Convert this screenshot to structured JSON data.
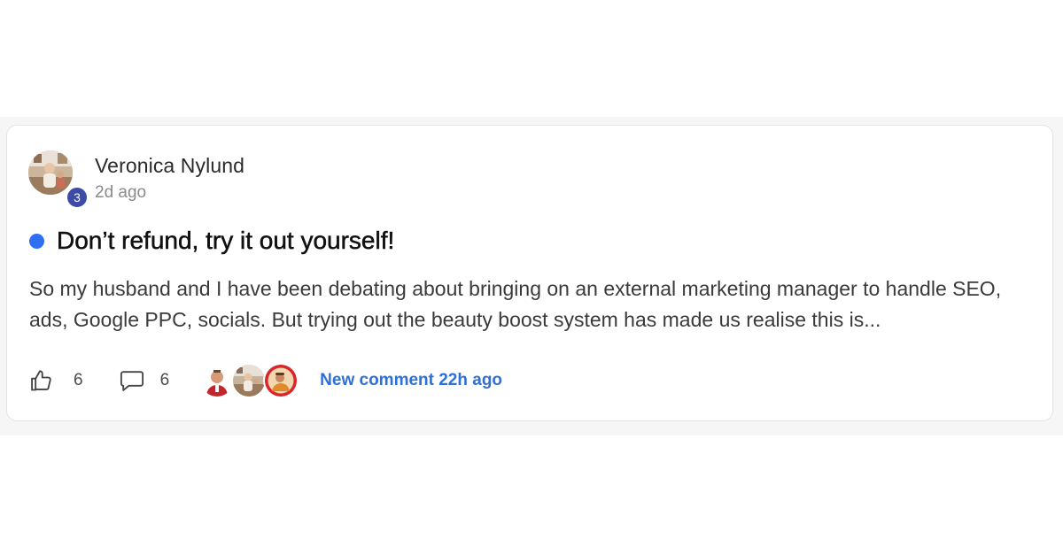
{
  "post": {
    "author": {
      "name": "Veronica Nylund",
      "level": "3",
      "avatar_icon": "user-avatar-photo"
    },
    "time": "2d ago",
    "unread": true,
    "title": "Don’t refund, try it out yourself!",
    "body": "So my husband and I have been debating about bringing on an external marketing manager to handle SEO, ads, Google PPC, socials. But trying out the beauty boost system has made us realise this is...",
    "likes": "6",
    "comments": "6",
    "like_icon": "thumbs-up-icon",
    "comment_icon": "speech-bubble-icon",
    "recent_commenters": [
      {
        "avatar_icon": "commenter-avatar-photo"
      },
      {
        "avatar_icon": "commenter-avatar-photo"
      },
      {
        "avatar_icon": "commenter-avatar-photo"
      }
    ],
    "new_comment_label": "New comment 22h ago"
  },
  "colors": {
    "accent_blue": "#2f6ff2",
    "link_blue": "#2f6fd8",
    "badge_indigo": "#3d4aa6",
    "card_border": "#e4e4e4"
  }
}
